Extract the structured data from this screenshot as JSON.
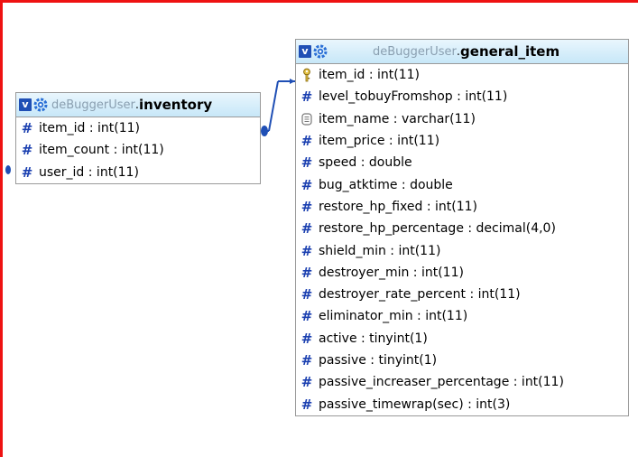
{
  "inventory_table": {
    "schema": "deBuggerUser",
    "separator": ".",
    "name": "inventory",
    "fields": [
      {
        "label": "item_id : int(11)",
        "icon": "hash-icon"
      },
      {
        "label": "item_count : int(11)",
        "icon": "hash-icon"
      },
      {
        "label": "user_id : int(11)",
        "icon": "hash-icon"
      }
    ]
  },
  "general_item_table": {
    "schema": "deBuggerUser",
    "separator": ".",
    "name": "general_item",
    "fields": [
      {
        "label": "item_id : int(11)",
        "icon": "key-icon"
      },
      {
        "label": "level_tobuyFromshop : int(11)",
        "icon": "hash-icon"
      },
      {
        "label": "item_name : varchar(11)",
        "icon": "text-field-icon"
      },
      {
        "label": "item_price : int(11)",
        "icon": "hash-icon"
      },
      {
        "label": "speed : double",
        "icon": "hash-icon"
      },
      {
        "label": "bug_atktime : double",
        "icon": "hash-icon"
      },
      {
        "label": "restore_hp_fixed : int(11)",
        "icon": "hash-icon"
      },
      {
        "label": "restore_hp_percentage : decimal(4,0)",
        "icon": "hash-icon"
      },
      {
        "label": "shield_min : int(11)",
        "icon": "hash-icon"
      },
      {
        "label": "destroyer_min : int(11)",
        "icon": "hash-icon"
      },
      {
        "label": "destroyer_rate_percent : int(11)",
        "icon": "hash-icon"
      },
      {
        "label": "eliminator_min : int(11)",
        "icon": "hash-icon"
      },
      {
        "label": "active : tinyint(1)",
        "icon": "hash-icon"
      },
      {
        "label": "passive : tinyint(1)",
        "icon": "hash-icon"
      },
      {
        "label": "passive_increaser_percentage : int(11)",
        "icon": "hash-icon"
      },
      {
        "label": "passive_timewrap(sec) : int(3)",
        "icon": "hash-icon"
      }
    ]
  },
  "toggle_label": "v",
  "hash_glyph": "#",
  "colors": {
    "frame": "#ee1111",
    "header_gradient_top": "#e9f6fd",
    "header_gradient_bottom": "#c7e7f8",
    "hash_blue": "#1a3fb0",
    "connector": "#1f4fb5",
    "schema_text": "#8a9fb0"
  }
}
